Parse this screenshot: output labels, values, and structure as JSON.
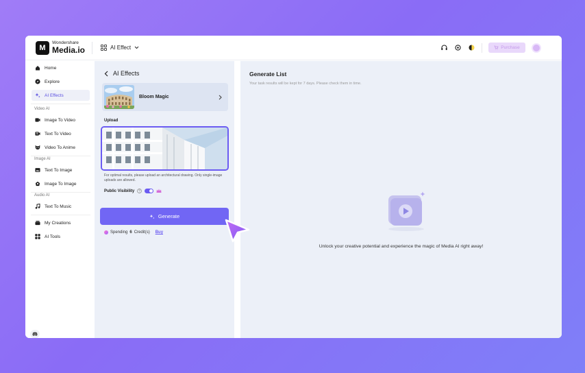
{
  "header": {
    "logo_mark": "M",
    "brand_top": "Wondershare",
    "brand_bottom": "Media.io",
    "effect_dropdown": "AI Effect",
    "purchase_label": "Purchase"
  },
  "sidebar": {
    "home": "Home",
    "explore": "Explore",
    "ai_effects": "AI Effects",
    "video_ai_label": "Video AI",
    "image_to_video": "Image To Video",
    "text_to_video": "Text To Video",
    "video_to_anime": "Video To Anime",
    "image_ai_label": "Image AI",
    "text_to_image": "Text To Image",
    "image_to_image": "Image To Image",
    "audio_ai_label": "Audio AI",
    "text_to_music": "Text To Music",
    "my_creations": "My Creations",
    "ai_tools": "AI Tools"
  },
  "panel": {
    "title": "AI Effects",
    "effect_name": "Bloom Magic",
    "upload_label": "Upload",
    "hint": "For optimal results, please upload an architectural drawing. Only single-image uploads are allowed.",
    "visibility_label": "Public Visibility",
    "generate_label": "Generate",
    "spending_prefix": "Spending",
    "spending_amount": "6",
    "spending_suffix": "Credit(s)",
    "buy_label": "Buy"
  },
  "main": {
    "title": "Generate List",
    "subtitle": "Your task results will be kept for 7 days. Please check them in time.",
    "empty_message": "Unlock your creative potential and experience the magic of Media AI right away!"
  },
  "colors": {
    "accent": "#7166f4",
    "background_start": "#a07cf7",
    "background_end": "#7f7ff8",
    "panel_bg": "#ecf0f8"
  }
}
